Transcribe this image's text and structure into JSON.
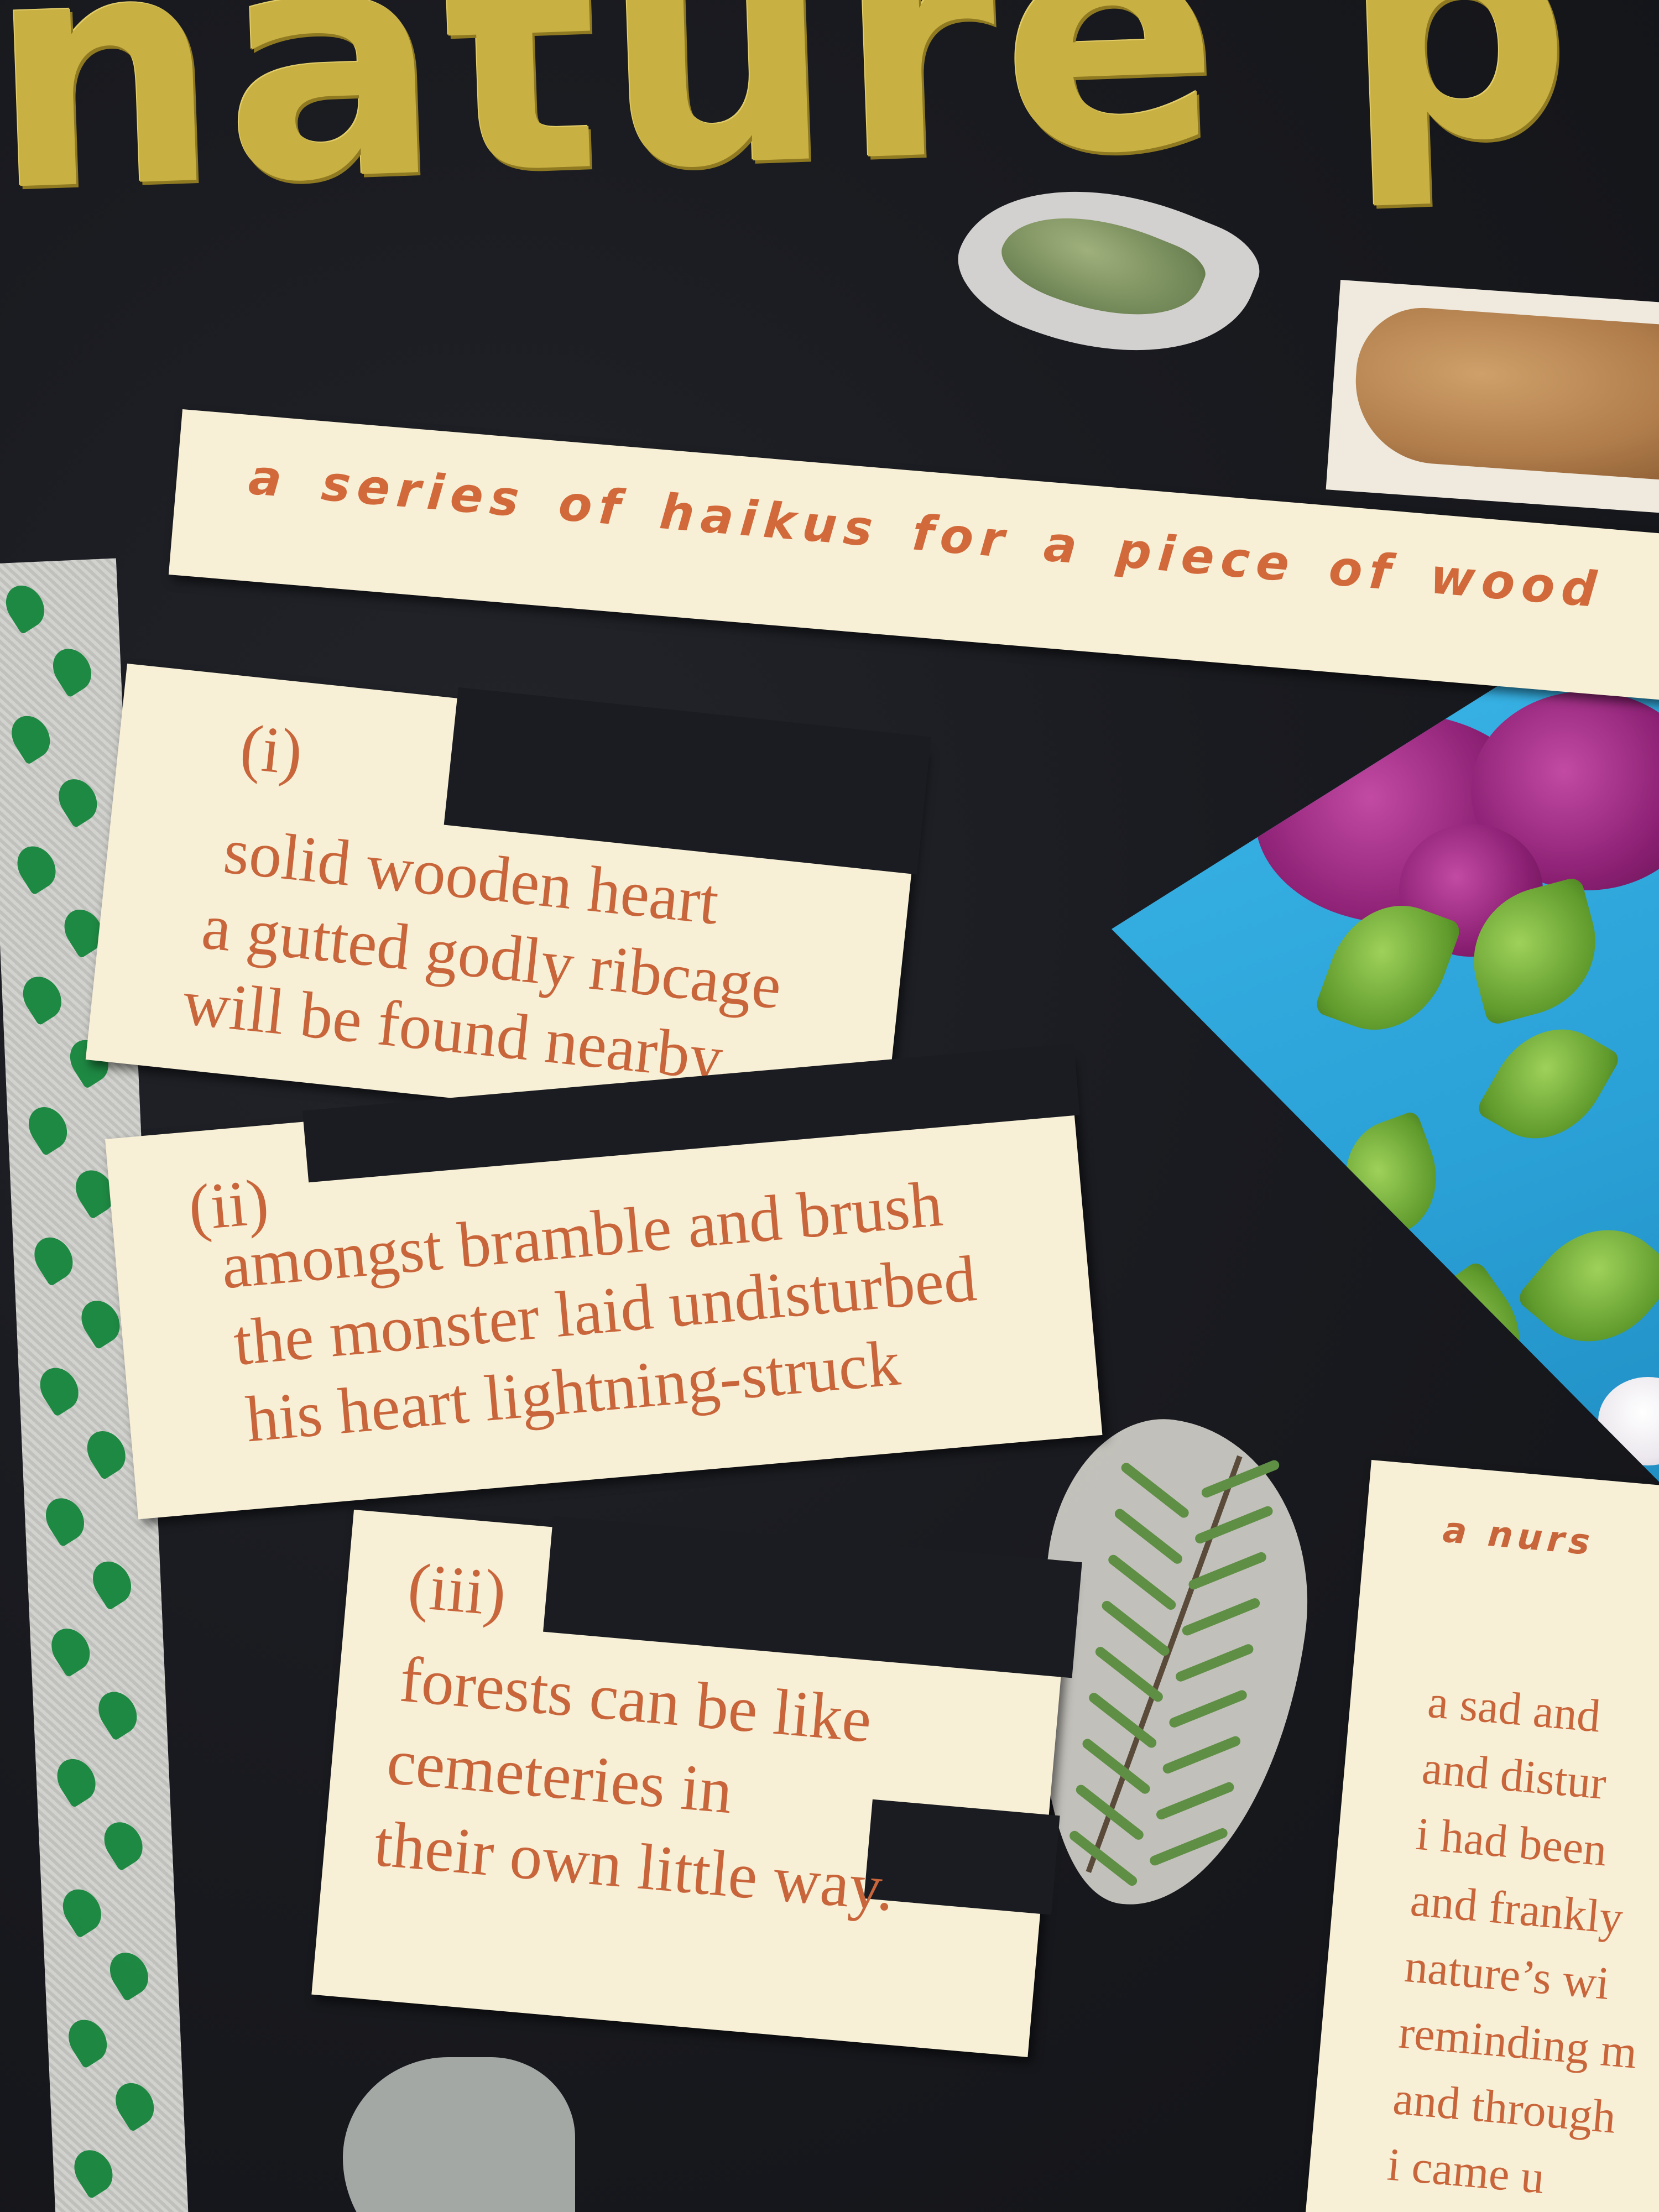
{
  "title": "nature p",
  "subtitle": "a series of haikus for a piece of wood",
  "haikus": [
    {
      "number": "(i)",
      "lines": [
        "solid wooden heart",
        "a gutted godly ribcage",
        "will be found nearby."
      ]
    },
    {
      "number": "(ii)",
      "lines": [
        "amongst bramble and brush",
        "the monster laid undisturbed",
        "his heart lightning-struck"
      ]
    },
    {
      "number": "(iii)",
      "lines": [
        "forests can be like",
        "cemeteries in",
        "their own little way."
      ]
    }
  ],
  "right_paper": {
    "heading": "a nurs",
    "lines": [
      "a sad and",
      "and distur",
      "i had been",
      "and frankly",
      "nature’s wi",
      "reminding m",
      "and through",
      "i came u"
    ]
  },
  "colors": {
    "board": "#16171b",
    "paper": "#f7efd6",
    "ink": "#c9653a",
    "gold": "#c9b043",
    "sky": "#2aa1d7"
  }
}
